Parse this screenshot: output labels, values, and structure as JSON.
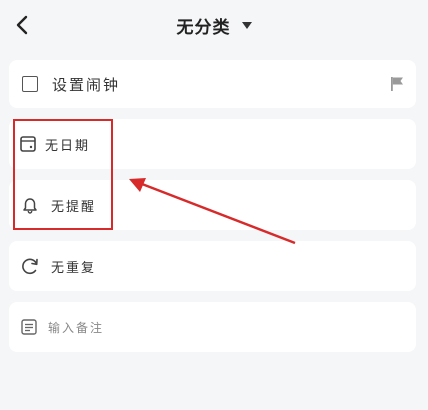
{
  "header": {
    "title": "无分类"
  },
  "task": {
    "title": "设置闹钟"
  },
  "fields": {
    "date": "无日期",
    "reminder": "无提醒",
    "repeat": "无重复",
    "note": "输入备注"
  },
  "colors": {
    "accent": "#d72a2a",
    "background": "#f5f6f8"
  },
  "icons": {
    "back": "chevron-left-icon",
    "dropdown": "caret-down-icon",
    "flag": "flag-icon",
    "calendar": "calendar-icon",
    "bell": "bell-icon",
    "repeat": "repeat-icon",
    "note": "note-icon"
  }
}
